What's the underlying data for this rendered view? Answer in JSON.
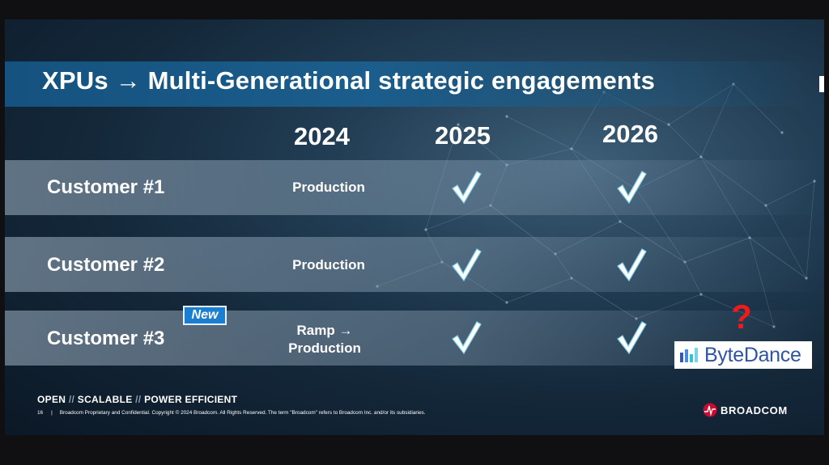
{
  "slide": {
    "title": "XPUs → Multi-Generational strategic engagements",
    "years": [
      "2024",
      "2025",
      "2026"
    ],
    "rows": [
      {
        "customer": "Customer #1",
        "status_line1": "Production",
        "status_line2": ""
      },
      {
        "customer": "Customer #2",
        "status_line1": "Production",
        "status_line2": ""
      },
      {
        "customer": "Customer #3",
        "status_line1": "Ramp →",
        "status_line2": "Production"
      }
    ],
    "new_badge": "New",
    "question_mark": "?",
    "bytedance_logo": "ByteDance",
    "tagline": {
      "open": "OPEN",
      "scalable": "SCALABLE",
      "power": "POWER EFFICIENT",
      "separator": "//"
    },
    "footer": {
      "page_number": "16",
      "pipe": "|",
      "legal": "Broadcom Proprietary and Confidential.  Copyright © 2024 Broadcom.  All Rights Reserved. The term \"Broadcom\" refers to Broadcom Inc. and/or its subsidiaries."
    },
    "brand": "BROADCOM",
    "colors": {
      "title_band": "#15527f",
      "check": "#ffffff",
      "new_badge": "#1a7fd0",
      "question": "#ee1b1b",
      "bytedance": "#2f53a6"
    },
    "icons": {
      "check": "check-icon",
      "bytedance_mark": "bytedance-bars-icon",
      "brand_mark": "broadcom-logo-icon"
    }
  }
}
